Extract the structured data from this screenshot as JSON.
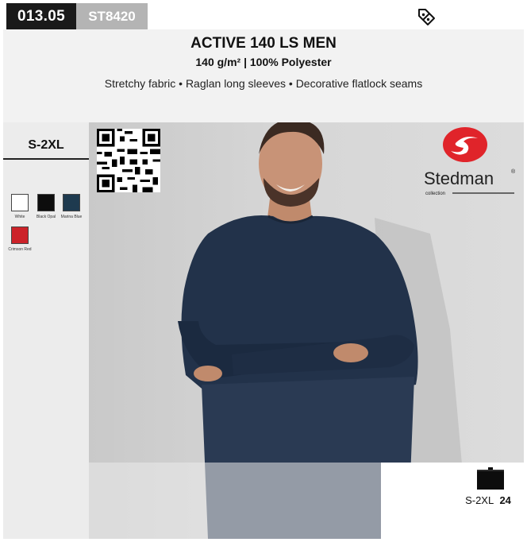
{
  "header": {
    "code": "013.05",
    "sku": "ST8420",
    "tag_icon": "tag-percent-icon"
  },
  "product": {
    "title": "ACTIVE 140 LS MEN",
    "subtitle": "140 g/m² | 100% Polyester",
    "features": "Stretchy fabric • Raglan long sleeves • Decorative flatlock seams"
  },
  "sizes": {
    "range": "S-2XL"
  },
  "colors": [
    {
      "name": "White",
      "hex": "#ffffff"
    },
    {
      "name": "Black Opal",
      "hex": "#0d0d0d"
    },
    {
      "name": "Marina Blue",
      "hex": "#1e3a4f"
    },
    {
      "name": "Crimson Red",
      "hex": "#cc2229"
    }
  ],
  "brand": {
    "name": "Stedman",
    "registered": "®",
    "collection": "collection",
    "logo_color": "#e0242a"
  },
  "packaging": {
    "size": "S-2XL",
    "quantity": "24"
  }
}
